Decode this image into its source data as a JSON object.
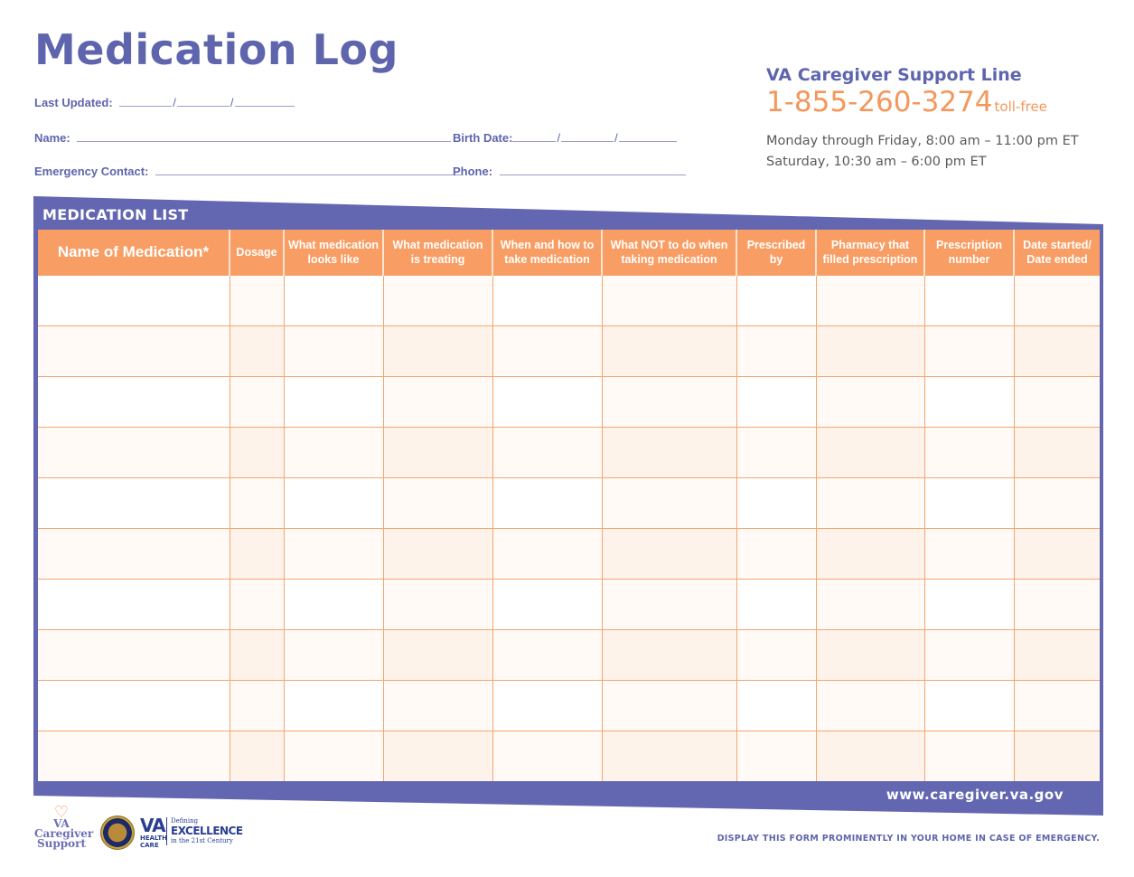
{
  "header": {
    "title": "Medication Log",
    "last_updated_label": "Last Updated:",
    "name_label": "Name:",
    "birth_date_label": "Birth Date:",
    "emergency_contact_label": "Emergency Contact:",
    "phone_label": "Phone:",
    "date_separator": "/"
  },
  "support_line": {
    "title": "VA Caregiver Support Line",
    "phone": "1-855-260-3274",
    "phone_suffix": "toll-free",
    "hours": [
      "Monday through Friday, 8:00 am – 11:00 pm ET",
      "Saturday, 10:30 am – 6:00 pm ET"
    ]
  },
  "medication_list": {
    "label": "MEDICATION LIST",
    "columns": [
      "Name of Medication*",
      "Dosage",
      "What medication looks like",
      "What medication is treating",
      "When and how to take medication",
      "What NOT to do when taking medication",
      "Prescribed by",
      "Pharmacy that filled prescription",
      "Prescription number",
      "Date started/ Date ended"
    ],
    "row_count": 10
  },
  "footer": {
    "url": "www.caregiver.va.gov",
    "display_note": "DISPLAY THIS FORM PROMINENTLY IN YOUR HOME IN CASE OF EMERGENCY.",
    "logo_caregiver": [
      "VA",
      "Caregiver",
      "Support"
    ],
    "logo_va_health_care": {
      "va": "VA",
      "sub": [
        "HEALTH",
        "CARE"
      ],
      "tagline": [
        "Defining",
        "EXCELLENCE",
        "in the 21st Century"
      ]
    }
  },
  "colors": {
    "brand_purple": "#6366b0",
    "accent_orange": "#f89d63",
    "text_gray": "#5a5a5a"
  }
}
